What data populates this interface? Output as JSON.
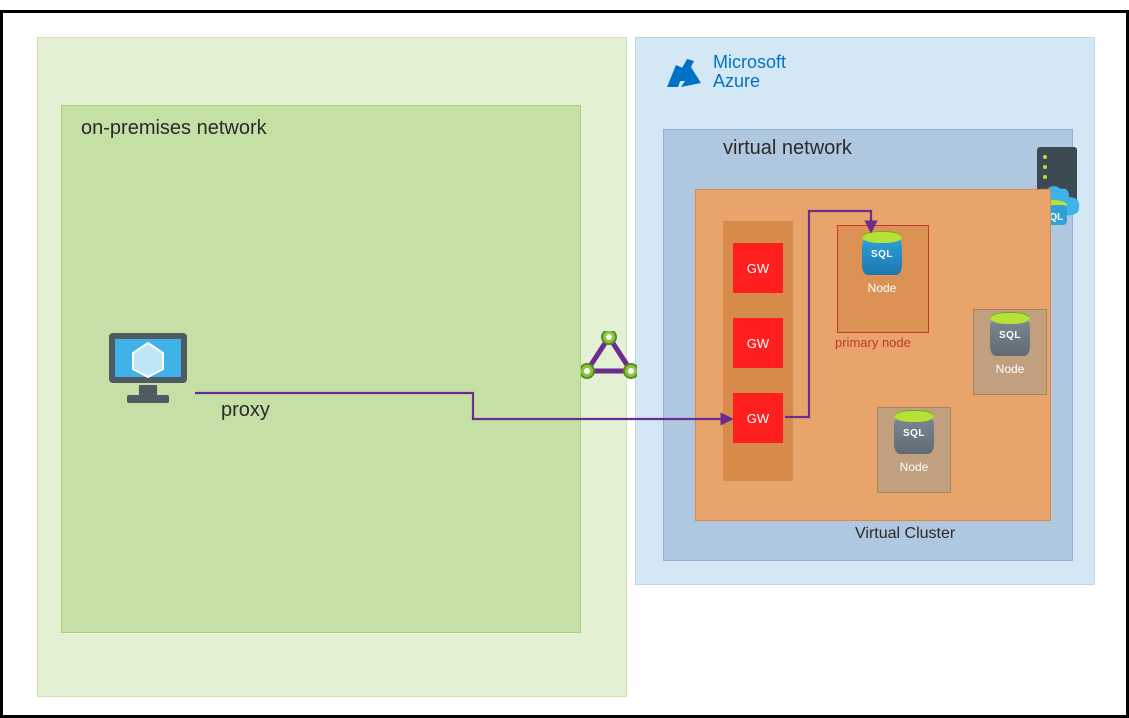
{
  "onprem": {
    "title": "on-premises network",
    "proxy_label": "proxy"
  },
  "azure": {
    "brand_line1": "Microsoft",
    "brand_line2": "Azure",
    "vnet_title": "virtual network",
    "cluster_title": "Virtual Cluster",
    "gw_label": "GW",
    "primary_label": "primary node",
    "node_label": "Node",
    "sql_label": "SQL"
  }
}
